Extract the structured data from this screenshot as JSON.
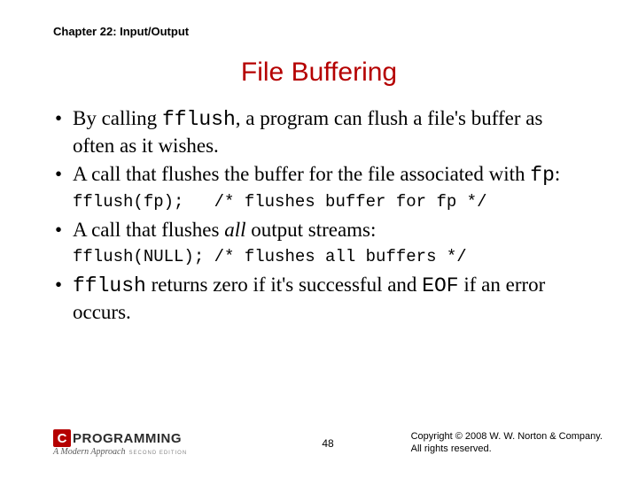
{
  "chapter": "Chapter 22: Input/Output",
  "title": "File Buffering",
  "bullets": {
    "b1a": "By calling ",
    "b1code": "fflush",
    "b1b": ", a program can flush a file's buffer as often as it wishes.",
    "b2a": "A call that flushes the buffer for the file associated with ",
    "b2code": "fp",
    "b2b": ":",
    "code1": "fflush(fp);   /* flushes buffer for fp */",
    "b3a": "A call that flushes ",
    "b3i": "all",
    "b3b": " output streams:",
    "code2": "fflush(NULL); /* flushes all buffers */",
    "b4code1": "fflush",
    "b4a": " returns zero if it's successful and ",
    "b4code2": "EOF",
    "b4b": " if an error occurs."
  },
  "logo": {
    "c": "C",
    "word": "PROGRAMMING",
    "sub": "A Modern Approach",
    "edition": "SECOND EDITION"
  },
  "page": "48",
  "copyright": {
    "l1": "Copyright © 2008 W. W. Norton & Company.",
    "l2": "All rights reserved."
  }
}
